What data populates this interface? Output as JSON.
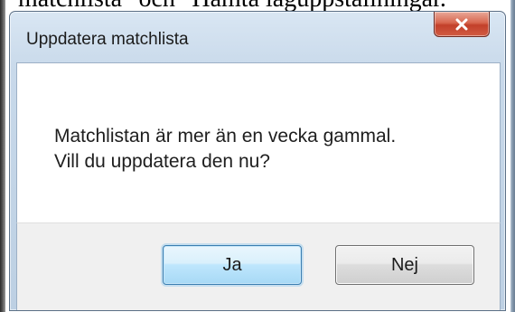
{
  "background_text": "matchlista\" och \"Hämta laguppställningar.",
  "dialog": {
    "title": "Uppdatera matchlista",
    "close_label": "x",
    "message_lines": [
      "Matchlistan är mer än en vecka gammal.",
      "Vill du uppdatera den nu?"
    ],
    "yes_label": "Ja",
    "no_label": "Nej"
  },
  "colors": {
    "titlebar": "#c8d9ea",
    "close_button": "#d15c43",
    "default_button_border": "#3c7fb1",
    "footer": "#f0f0f0"
  },
  "icons": {
    "close": "close-icon"
  }
}
